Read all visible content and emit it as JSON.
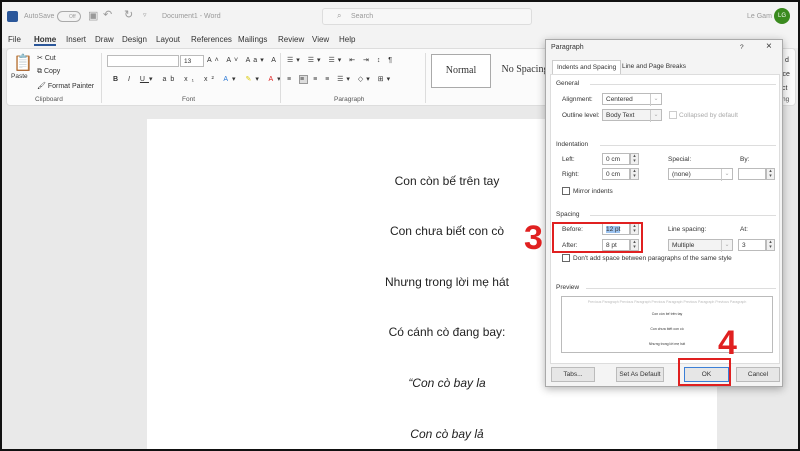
{
  "titlebar": {
    "autosave": "AutoSave",
    "autosave_state": "Off",
    "document_title": "Document1 - Word",
    "search_placeholder": "Search",
    "user_name": "Le Gam",
    "user_initials": "LG",
    "avatar_color": "#3a8a1e"
  },
  "menu_tabs": [
    "File",
    "Home",
    "Insert",
    "Draw",
    "Design",
    "Layout",
    "References",
    "Mailings",
    "Review",
    "View",
    "Help"
  ],
  "ribbon": {
    "paste": "Paste",
    "cut": "Cut",
    "copy": "Copy",
    "format_painter": "Format Painter",
    "clipboard": "Clipboard",
    "font_size": "13",
    "font": "Font",
    "paragraph": "Paragraph",
    "styles": [
      "Normal",
      "No Spacing"
    ],
    "editing_partial": [
      "d",
      "lace",
      "ct",
      "ng"
    ]
  },
  "document": {
    "lines": [
      "Con còn bế trên tay",
      "Con chưa biết con cò",
      "Nhưng trong lời mẹ hát",
      "Có cánh cò đang bay:",
      "“Con cò bay la",
      "Con cò bay lả"
    ]
  },
  "dialog": {
    "title": "Paragraph",
    "help": "?",
    "close": "×",
    "tabs": [
      "Indents and Spacing",
      "Line and Page Breaks"
    ],
    "general": {
      "heading": "General",
      "alignment_label": "Alignment:",
      "alignment": "Centered",
      "outline_label": "Outline level:",
      "outline": "Body Text",
      "collapsed": "Collapsed by default"
    },
    "indentation": {
      "heading": "Indentation",
      "left_label": "Left:",
      "left": "0 cm",
      "right_label": "Right:",
      "right": "0 cm",
      "special_label": "Special:",
      "special": "(none)",
      "by_label": "By:",
      "by": "",
      "mirror": "Mirror indents"
    },
    "spacing": {
      "heading": "Spacing",
      "before_label": "Before:",
      "before": "12 pt",
      "after_label": "After:",
      "after": "8 pt",
      "line_spacing_label": "Line spacing:",
      "line_spacing": "Multiple",
      "at_label": "At:",
      "at": "3",
      "dont_add": "Don't add space between paragraphs of the same style"
    },
    "preview": {
      "heading": "Preview",
      "prev_text": "Previous Paragraph Previous Paragraph Previous Paragraph Previous Paragraph Previous Paragraph",
      "sample": [
        "Con còn bế trên tay",
        "Con chưa biết con cò",
        "Nhưng trong lời mẹ hát"
      ]
    },
    "buttons": {
      "tabs": "Tabs...",
      "set_default": "Set As Default",
      "ok": "OK",
      "cancel": "Cancel"
    }
  },
  "annotations": {
    "step3": "3",
    "step4": "4",
    "highlight_color": "#e02020"
  }
}
